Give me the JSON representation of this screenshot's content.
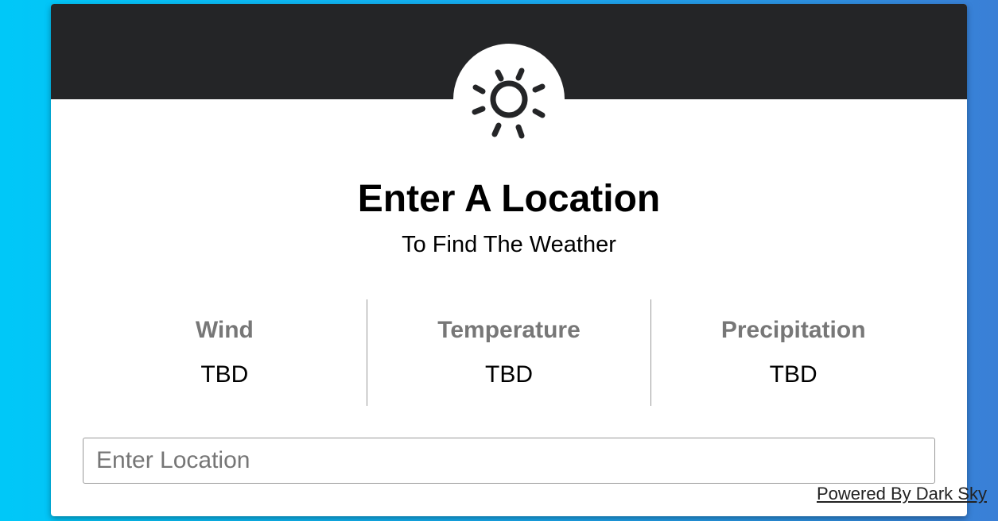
{
  "header": {
    "icon": "sun-icon"
  },
  "main": {
    "title": "Enter A Location",
    "subtitle": "To Find The Weather"
  },
  "stats": [
    {
      "label": "Wind",
      "value": "TBD"
    },
    {
      "label": "Temperature",
      "value": "TBD"
    },
    {
      "label": "Precipitation",
      "value": "TBD"
    }
  ],
  "search": {
    "placeholder": "Enter Location",
    "value": ""
  },
  "footer": {
    "powered_by": "Powered By Dark Sky"
  },
  "colors": {
    "header_bg": "#242527",
    "card_bg": "#ffffff",
    "label_gray": "#777777",
    "background_start": "#00c8f8",
    "background_end": "#3a7fd6"
  }
}
